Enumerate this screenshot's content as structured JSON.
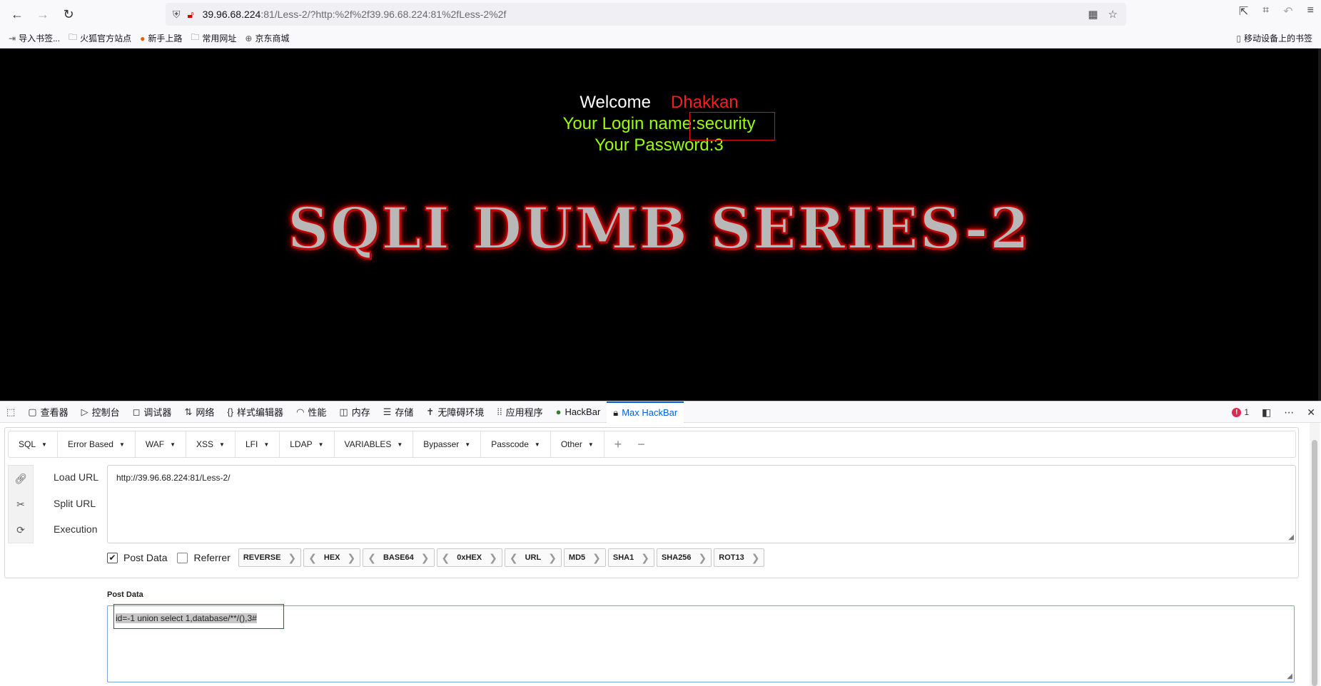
{
  "browser": {
    "url_host": "39.96.68.224",
    "url_rest": ":81/Less-2/?http:%2f%2f39.96.68.224:81%2fLess-2%2f",
    "bookmarks": [
      "导入书签...",
      "火狐官方站点",
      "新手上路",
      "常用网址",
      "京东商城"
    ],
    "mobile_bookmarks": "移动设备上的书签"
  },
  "page": {
    "welcome": "Welcome",
    "user": "Dhakkan",
    "login_line": "Your Login name:security",
    "password_line": "Your Password:3",
    "title": "SQLI DUMB SERIES-2"
  },
  "devtools": {
    "tabs": [
      "查看器",
      "控制台",
      "调试器",
      "网络",
      "样式编辑器",
      "性能",
      "内存",
      "存储",
      "无障碍环境",
      "应用程序",
      "HackBar",
      "Max HackBar"
    ],
    "error_count": "1"
  },
  "hackbar": {
    "menu": [
      "SQL",
      "Error Based",
      "WAF",
      "XSS",
      "LFI",
      "LDAP",
      "VARIABLES",
      "Bypasser",
      "Passcode",
      "Other"
    ],
    "actions": [
      "Load URL",
      "Split URL",
      "Execution"
    ],
    "url_value": "http://39.96.68.224:81/Less-2/",
    "post_data_checkbox": "Post Data",
    "referrer_checkbox": "Referrer",
    "encoders": [
      "REVERSE",
      "HEX",
      "BASE64",
      "0xHEX",
      "URL",
      "MD5",
      "SHA1",
      "SHA256",
      "ROT13"
    ],
    "post_data_label": "Post Data",
    "post_data_value": "id=-1 union select 1,database/**/(),3#"
  },
  "colors": {
    "welcome_red": "#ff1c1c",
    "login_green": "#99ff00",
    "active_tab": "#0061e0",
    "highlight_red": "#e01010"
  }
}
